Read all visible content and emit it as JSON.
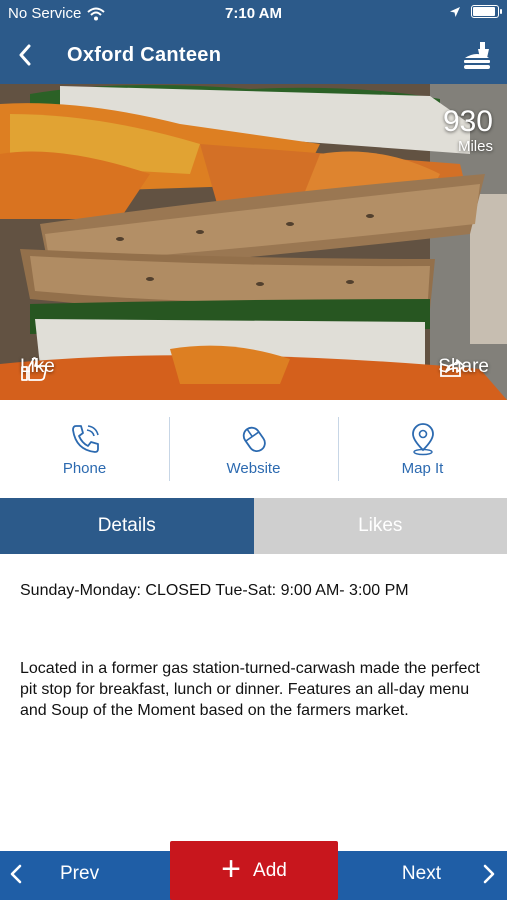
{
  "status": {
    "carrier": "No Service",
    "time": "7:10 AM",
    "icons": [
      "wifi-icon",
      "location-arrow-icon",
      "battery-icon"
    ]
  },
  "nav": {
    "title": "Oxford Canteen",
    "back_icon": "chevron-left-icon",
    "right_icon": "food-beverage-icon"
  },
  "hero": {
    "distance_value": "930",
    "distance_unit": "Miles",
    "like_label": "Like",
    "share_label": "Share"
  },
  "actions": [
    {
      "label": "Phone",
      "icon": "phone-icon"
    },
    {
      "label": "Website",
      "icon": "mouse-icon"
    },
    {
      "label": "Map It",
      "icon": "map-pin-icon"
    }
  ],
  "tabs": [
    {
      "label": "Details",
      "active": true
    },
    {
      "label": "Likes",
      "active": false
    }
  ],
  "details": {
    "hours": "Sunday-Monday: CLOSED Tue-Sat: 9:00 AM- 3:00 PM",
    "description": "Located in a former gas station-turned-carwash made the perfect pit stop for breakfast, lunch or dinner. Features an all-day menu and Soup of the Moment based on the farmers market."
  },
  "bottom": {
    "prev_label": "Prev",
    "add_label": "Add",
    "next_label": "Next"
  },
  "colors": {
    "header": "#2c5a8a",
    "accent_blue": "#2c6ab0",
    "bottom_bar": "#1f5ea6",
    "add_red": "#c8161d",
    "tab_inactive": "#cfcfcf"
  }
}
